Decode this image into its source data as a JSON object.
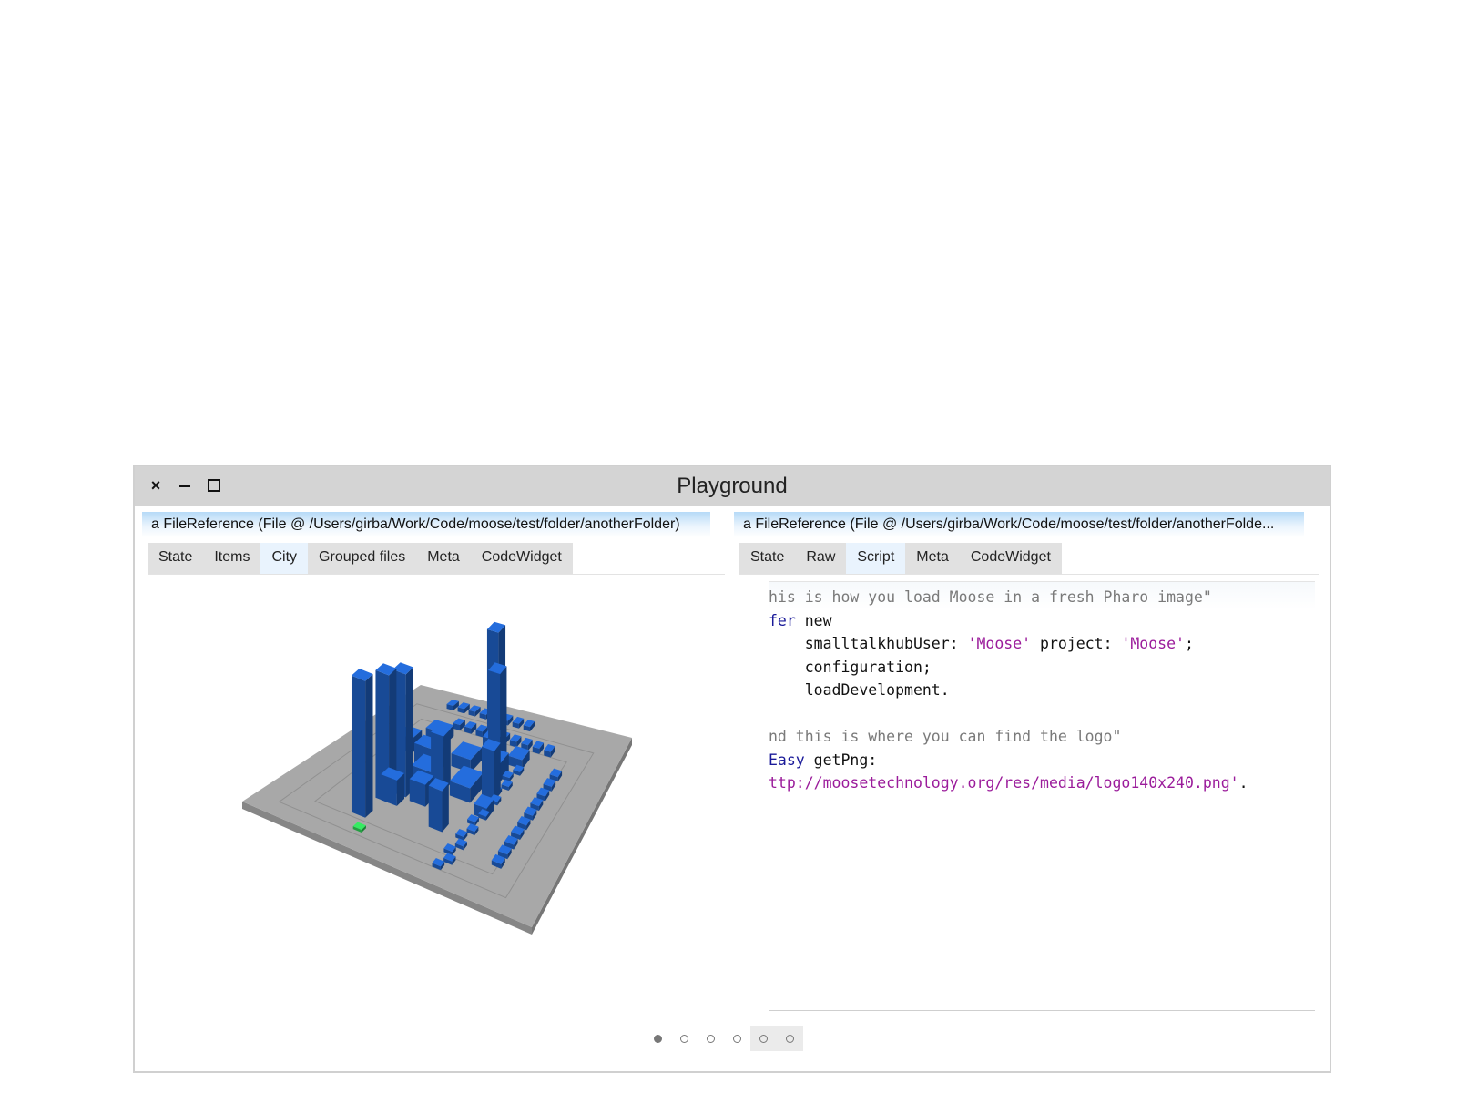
{
  "window": {
    "title": "Playground",
    "close_glyph": "×"
  },
  "left_pane": {
    "title": "a FileReference (File @ /Users/girba/Work/Code/moose/test/folder/anotherFolder)",
    "tabs": [
      {
        "label": "State"
      },
      {
        "label": "Items"
      },
      {
        "label": "City",
        "active": true
      },
      {
        "label": "Grouped files"
      },
      {
        "label": "Meta"
      },
      {
        "label": "CodeWidget"
      }
    ]
  },
  "right_pane": {
    "title": "a FileReference (File @ /Users/girba/Work/Code/moose/test/folder/anotherFolde...",
    "tabs": [
      {
        "label": "State"
      },
      {
        "label": "Raw"
      },
      {
        "label": "Script",
        "active": true
      },
      {
        "label": "Meta"
      },
      {
        "label": "CodeWidget"
      }
    ],
    "code_lines": [
      [
        {
          "t": "his is how you load Moose in a fresh Pharo image\"",
          "c": "cmt"
        }
      ],
      [
        {
          "t": "fer",
          "c": "cls"
        },
        {
          "t": " new",
          "c": ""
        }
      ],
      [
        {
          "t": "    smalltalkhubUser: ",
          "c": ""
        },
        {
          "t": "'Moose'",
          "c": "str"
        },
        {
          "t": " project: ",
          "c": ""
        },
        {
          "t": "'Moose'",
          "c": "str"
        },
        {
          "t": ";",
          "c": ""
        }
      ],
      [
        {
          "t": "    configuration;",
          "c": ""
        }
      ],
      [
        {
          "t": "    loadDevelopment.",
          "c": ""
        }
      ],
      [
        {
          "t": "",
          "c": ""
        }
      ],
      [
        {
          "t": "nd this is where you can find the logo\"",
          "c": "cmt"
        }
      ],
      [
        {
          "t": "Easy",
          "c": "cls"
        },
        {
          "t": " getPng:",
          "c": ""
        }
      ],
      [
        {
          "t": "ttp://moosetechnology.org/res/media/logo140x240.png'",
          "c": "str"
        },
        {
          "t": ".",
          "c": ""
        }
      ]
    ]
  },
  "city_view": {
    "base_color": "#a8a8a8",
    "building_color": "#1f5fc0",
    "highlight_color": "#2ecc55"
  },
  "pager": {
    "count": 6,
    "active_index": 0,
    "shaded_indices": [
      4,
      5
    ]
  }
}
